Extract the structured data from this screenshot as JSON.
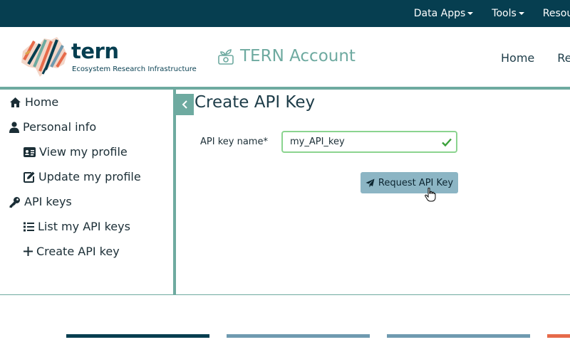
{
  "topbar": {
    "items": [
      {
        "label": "Data Apps"
      },
      {
        "label": "Tools"
      },
      {
        "label": "Resour"
      }
    ]
  },
  "header": {
    "brand_name": "tern",
    "brand_subtitle": "Ecosystem Research Infrastructure",
    "account_title": "TERN Account",
    "nav": [
      "Home",
      "Res"
    ]
  },
  "sidebar": {
    "items": [
      {
        "label": "Home",
        "icon": "home-icon"
      },
      {
        "label": "Personal info",
        "icon": "user-icon"
      },
      {
        "label": "View my profile",
        "icon": "id-card-icon"
      },
      {
        "label": "Update my profile",
        "icon": "edit-icon"
      },
      {
        "label": "API keys",
        "icon": "key-icon"
      },
      {
        "label": "List my API keys",
        "icon": "list-icon"
      },
      {
        "label": "Create API key",
        "icon": "plus-icon"
      }
    ]
  },
  "main": {
    "title": "Create API Key",
    "form": {
      "label": "API key name*",
      "value": "my_API_key",
      "submit_label": "Request API Key"
    }
  },
  "colors": {
    "topbar": "#063e50",
    "accent": "#6eaaa0",
    "button": "#8cb5c4",
    "valid": "#8bd48f",
    "footer_bars": [
      "#063e50",
      "#6f9ab0",
      "#6f9ab0",
      "#e66a4a"
    ]
  }
}
